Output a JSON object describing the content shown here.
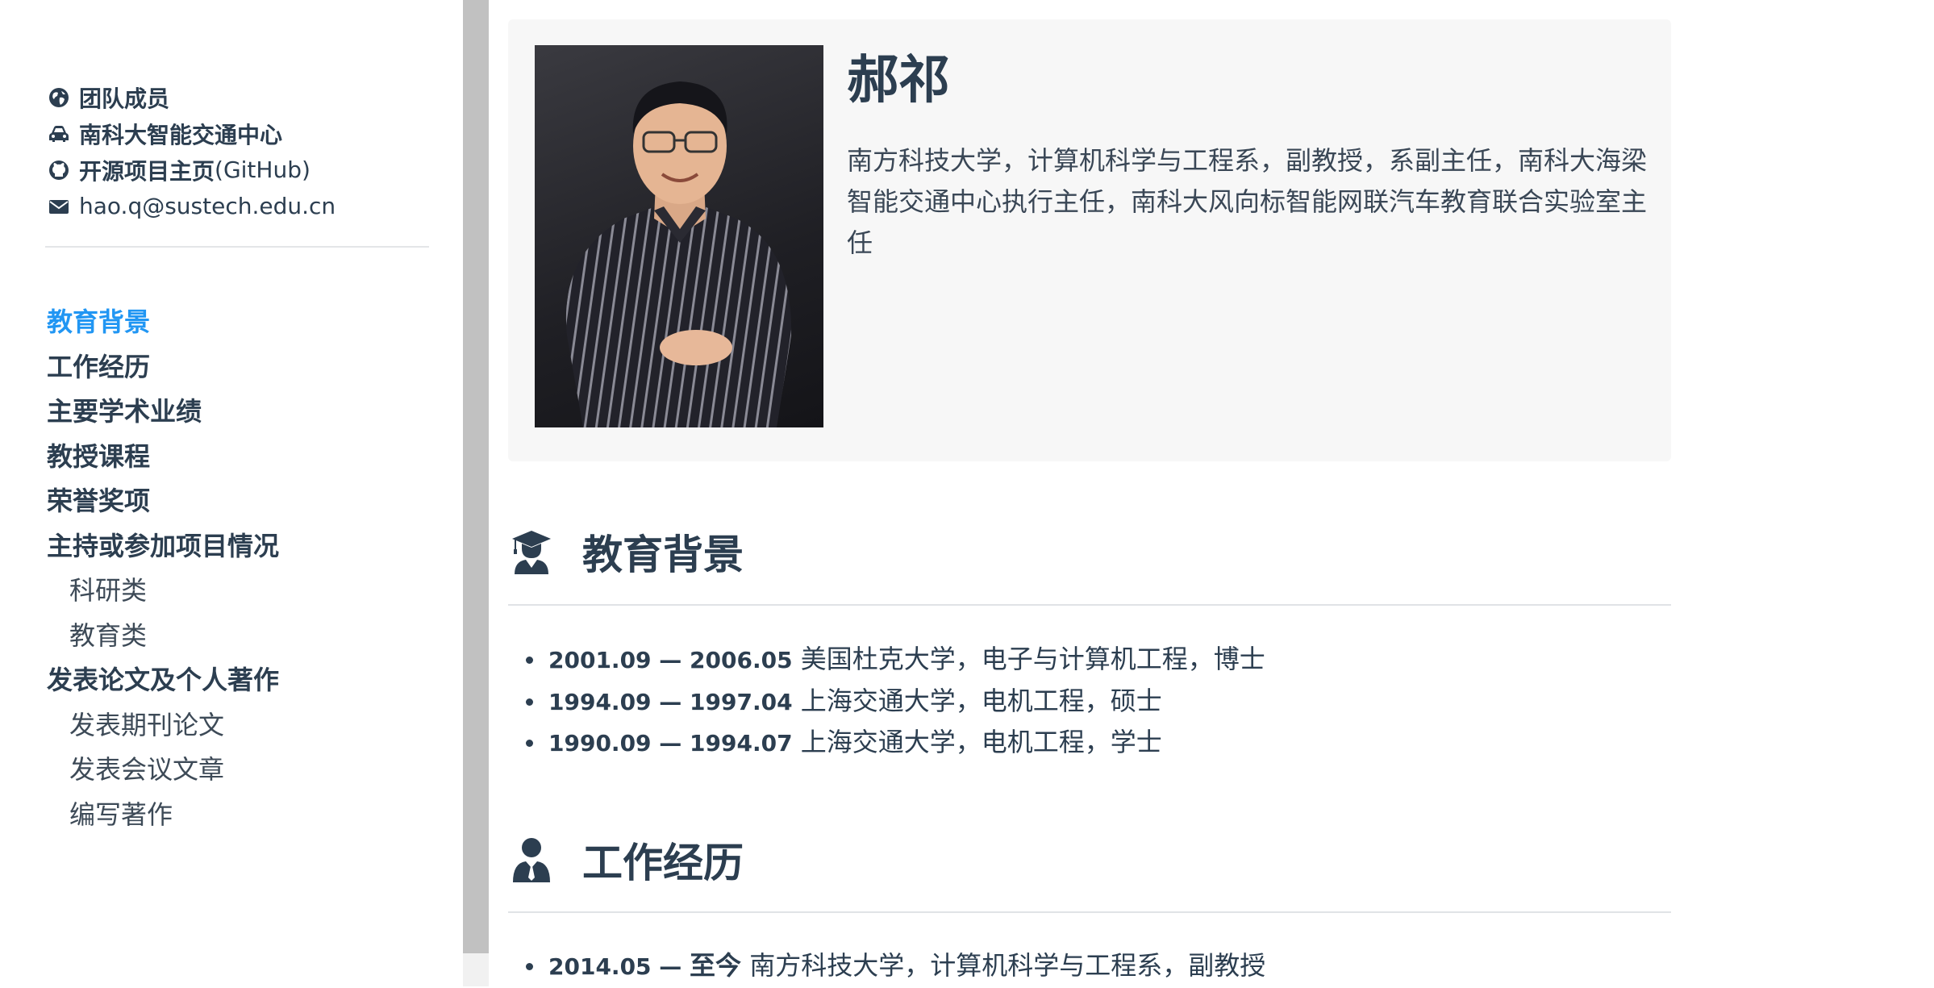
{
  "sidebar": {
    "links": [
      {
        "icon": "globe-icon",
        "label": "团队成员",
        "suffix": ""
      },
      {
        "icon": "car-icon",
        "label": "南科大智能交通中心",
        "suffix": ""
      },
      {
        "icon": "github-icon",
        "label": "开源项目主页",
        "suffix": "(GitHub)"
      },
      {
        "icon": "envelope-icon",
        "label": "hao.q@sustech.edu.cn",
        "suffix": ""
      }
    ],
    "toc": [
      {
        "label": "教育背景",
        "level": 1,
        "active": true
      },
      {
        "label": "工作经历",
        "level": 1
      },
      {
        "label": "主要学术业绩",
        "level": 1
      },
      {
        "label": "教授课程",
        "level": 1
      },
      {
        "label": "荣誉奖项",
        "level": 1
      },
      {
        "label": "主持或参加项目情况",
        "level": 1
      },
      {
        "label": "科研类",
        "level": 2
      },
      {
        "label": "教育类",
        "level": 2
      },
      {
        "label": "发表论文及个人著作",
        "level": 1
      },
      {
        "label": "发表期刊论文",
        "level": 2
      },
      {
        "label": "发表会议文章",
        "level": 2
      },
      {
        "label": "编写著作",
        "level": 2
      }
    ],
    "active_color": "#2196f3"
  },
  "profile": {
    "name": "郝祁",
    "description": "南方科技大学，计算机科学与工程系，副教授，系副主任，南科大海梁智能交通中心执行主任，南科大风向标智能网联汽车教育联合实验室主任"
  },
  "education": {
    "heading": "教育背景",
    "icon": "graduate-icon",
    "items": [
      {
        "period": "2001.09 — 2006.05",
        "text": "美国杜克大学，电子与计算机工程，博士"
      },
      {
        "period": "1994.09 — 1997.04",
        "text": "上海交通大学，电机工程，硕士"
      },
      {
        "period": "1990.09 — 1994.07",
        "text": "上海交通大学，电机工程，学士"
      }
    ]
  },
  "work": {
    "heading": "工作经历",
    "icon": "user-tie-icon",
    "items": [
      {
        "period": "2014.05 — ",
        "period_end": "至今",
        "text": "南方科技大学，计算机科学与工程系，副教授"
      }
    ]
  }
}
